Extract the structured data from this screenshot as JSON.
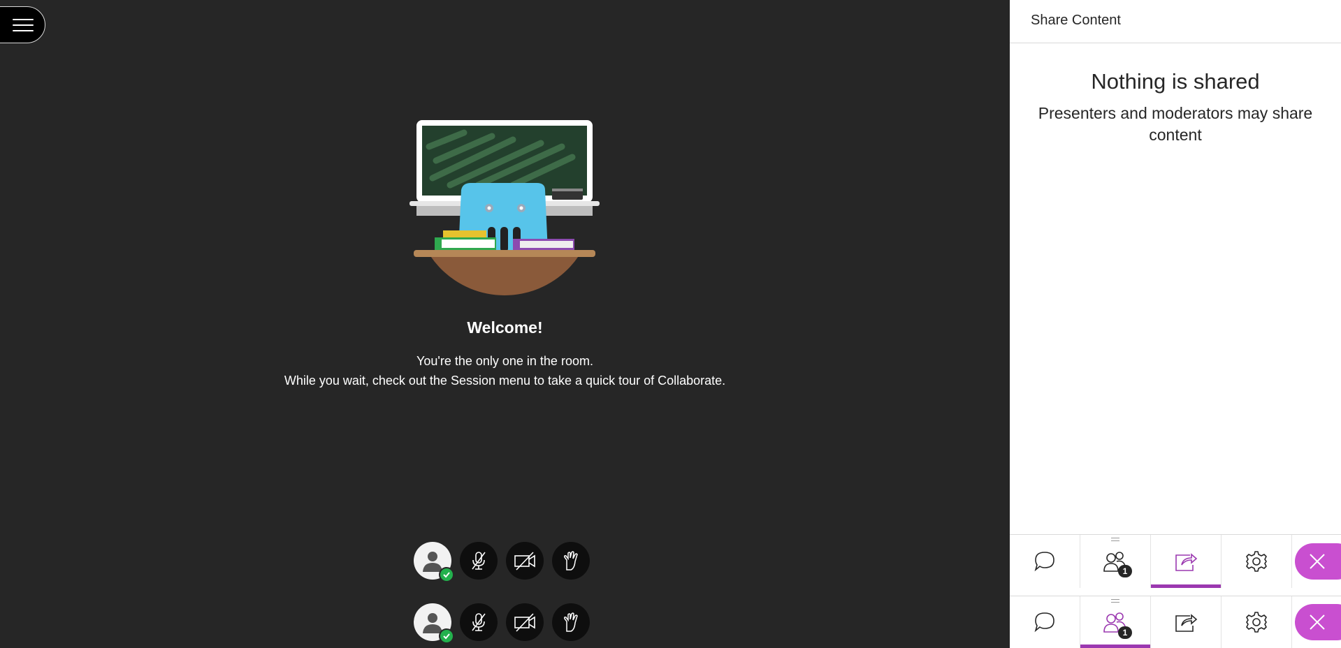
{
  "session_menu": {
    "icon": "hamburger-icon"
  },
  "welcome": {
    "title": "Welcome!",
    "line1": "You're the only one in the room.",
    "line2": "While you wait, check out the Session menu to take a quick tour of Collaborate."
  },
  "panel": {
    "header": "Share Content",
    "empty_title": "Nothing is shared",
    "empty_subtitle": "Presenters and moderators may share content"
  },
  "attendee_count": "1",
  "tabbars": [
    {
      "active": "share",
      "tabs": [
        "chat-icon",
        "attendees-icon",
        "share-icon",
        "gear-icon"
      ]
    },
    {
      "active": "attendees",
      "tabs": [
        "chat-icon",
        "attendees-icon",
        "share-icon",
        "gear-icon"
      ]
    }
  ],
  "colors": {
    "accent": "#9b38b0",
    "close": "#c94fd0",
    "status_ok": "#23b14d",
    "stage": "#262626"
  }
}
